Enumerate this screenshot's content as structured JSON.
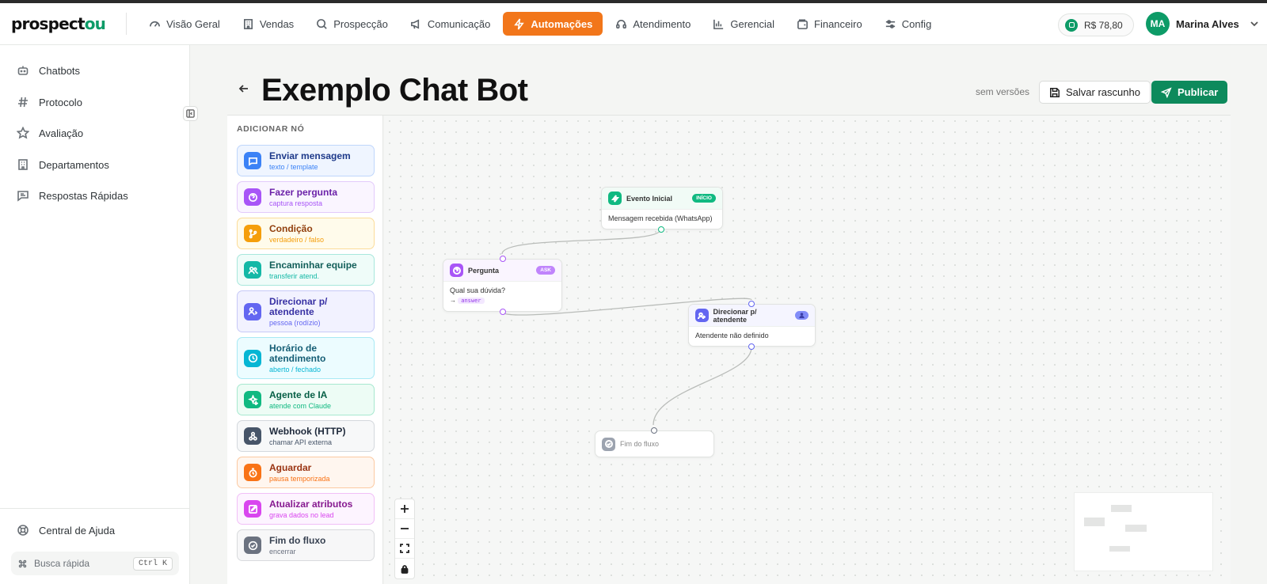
{
  "app": {
    "logo_main": "prospect",
    "logo_accent": "ou"
  },
  "topnav": {
    "items": [
      {
        "label": "Visão Geral",
        "icon": "gauge-icon"
      },
      {
        "label": "Vendas",
        "icon": "building-icon"
      },
      {
        "label": "Prospecção",
        "icon": "search-icon"
      },
      {
        "label": "Comunicação",
        "icon": "megaphone-icon"
      },
      {
        "label": "Automações",
        "icon": "lightning-icon",
        "active": true
      },
      {
        "label": "Atendimento",
        "icon": "headset-icon"
      },
      {
        "label": "Gerencial",
        "icon": "bar-chart-icon"
      },
      {
        "label": "Financeiro",
        "icon": "wallet-icon"
      },
      {
        "label": "Config",
        "icon": "sliders-icon"
      }
    ],
    "balance": "R$ 78,80",
    "user_initials": "MA",
    "user_name": "Marina Alves"
  },
  "sidebar": {
    "items": [
      {
        "label": "Chatbots",
        "icon": "bot-icon"
      },
      {
        "label": "Protocolo",
        "icon": "hash-icon"
      },
      {
        "label": "Avaliação",
        "icon": "star-icon"
      },
      {
        "label": "Departamentos",
        "icon": "building-icon"
      },
      {
        "label": "Respostas Rápidas",
        "icon": "message-reply-icon"
      }
    ],
    "help_label": "Central de Ajuda",
    "quick_search_placeholder": "Busca rápida",
    "quick_search_shortcut": "Ctrl K"
  },
  "editor": {
    "title": "Exemplo Chat Bot",
    "versions_text": "sem versões",
    "save_draft_label": "Salvar rascunho",
    "publish_label": "Publicar"
  },
  "palette": {
    "title": "ADICIONAR NÓ",
    "items": [
      {
        "label": "Enviar mensagem",
        "sub": "texto / template",
        "color": "#3b82f6"
      },
      {
        "label": "Fazer pergunta",
        "sub": "captura resposta",
        "color": "#a855f7"
      },
      {
        "label": "Condição",
        "sub": "verdadeiro / falso",
        "color": "#f59e0b"
      },
      {
        "label": "Encaminhar equipe",
        "sub": "transferir atend.",
        "color": "#14b8a6"
      },
      {
        "label": "Direcionar p/ atendente",
        "sub": "pessoa (rodízio)",
        "color": "#6366f1"
      },
      {
        "label": "Horário de atendimento",
        "sub": "aberto / fechado",
        "color": "#06b6d4"
      },
      {
        "label": "Agente de IA",
        "sub": "atende com Claude",
        "color": "#10b981"
      },
      {
        "label": "Webhook (HTTP)",
        "sub": "chamar API externa",
        "color": "#475569"
      },
      {
        "label": "Aguardar",
        "sub": "pausa temporizada",
        "color": "#f97316"
      },
      {
        "label": "Atualizar atributos",
        "sub": "grava dados no lead",
        "color": "#d946ef"
      },
      {
        "label": "Fim do fluxo",
        "sub": "encerrar",
        "color": "#6b7280"
      }
    ]
  },
  "flow": {
    "start_node": {
      "title": "Evento Inicial",
      "badge": "INÍCIO",
      "body": "Mensagem recebida (WhatsApp)"
    },
    "question_node": {
      "title": "Pergunta",
      "badge": "ASK",
      "body": "Qual sua dúvida?",
      "var_arrow": "→",
      "var": "answer"
    },
    "agent_node": {
      "title": "Direcionar p/ atendente",
      "body": "Atendente não definido"
    },
    "end_node": {
      "title": "Fim do fluxo"
    }
  }
}
